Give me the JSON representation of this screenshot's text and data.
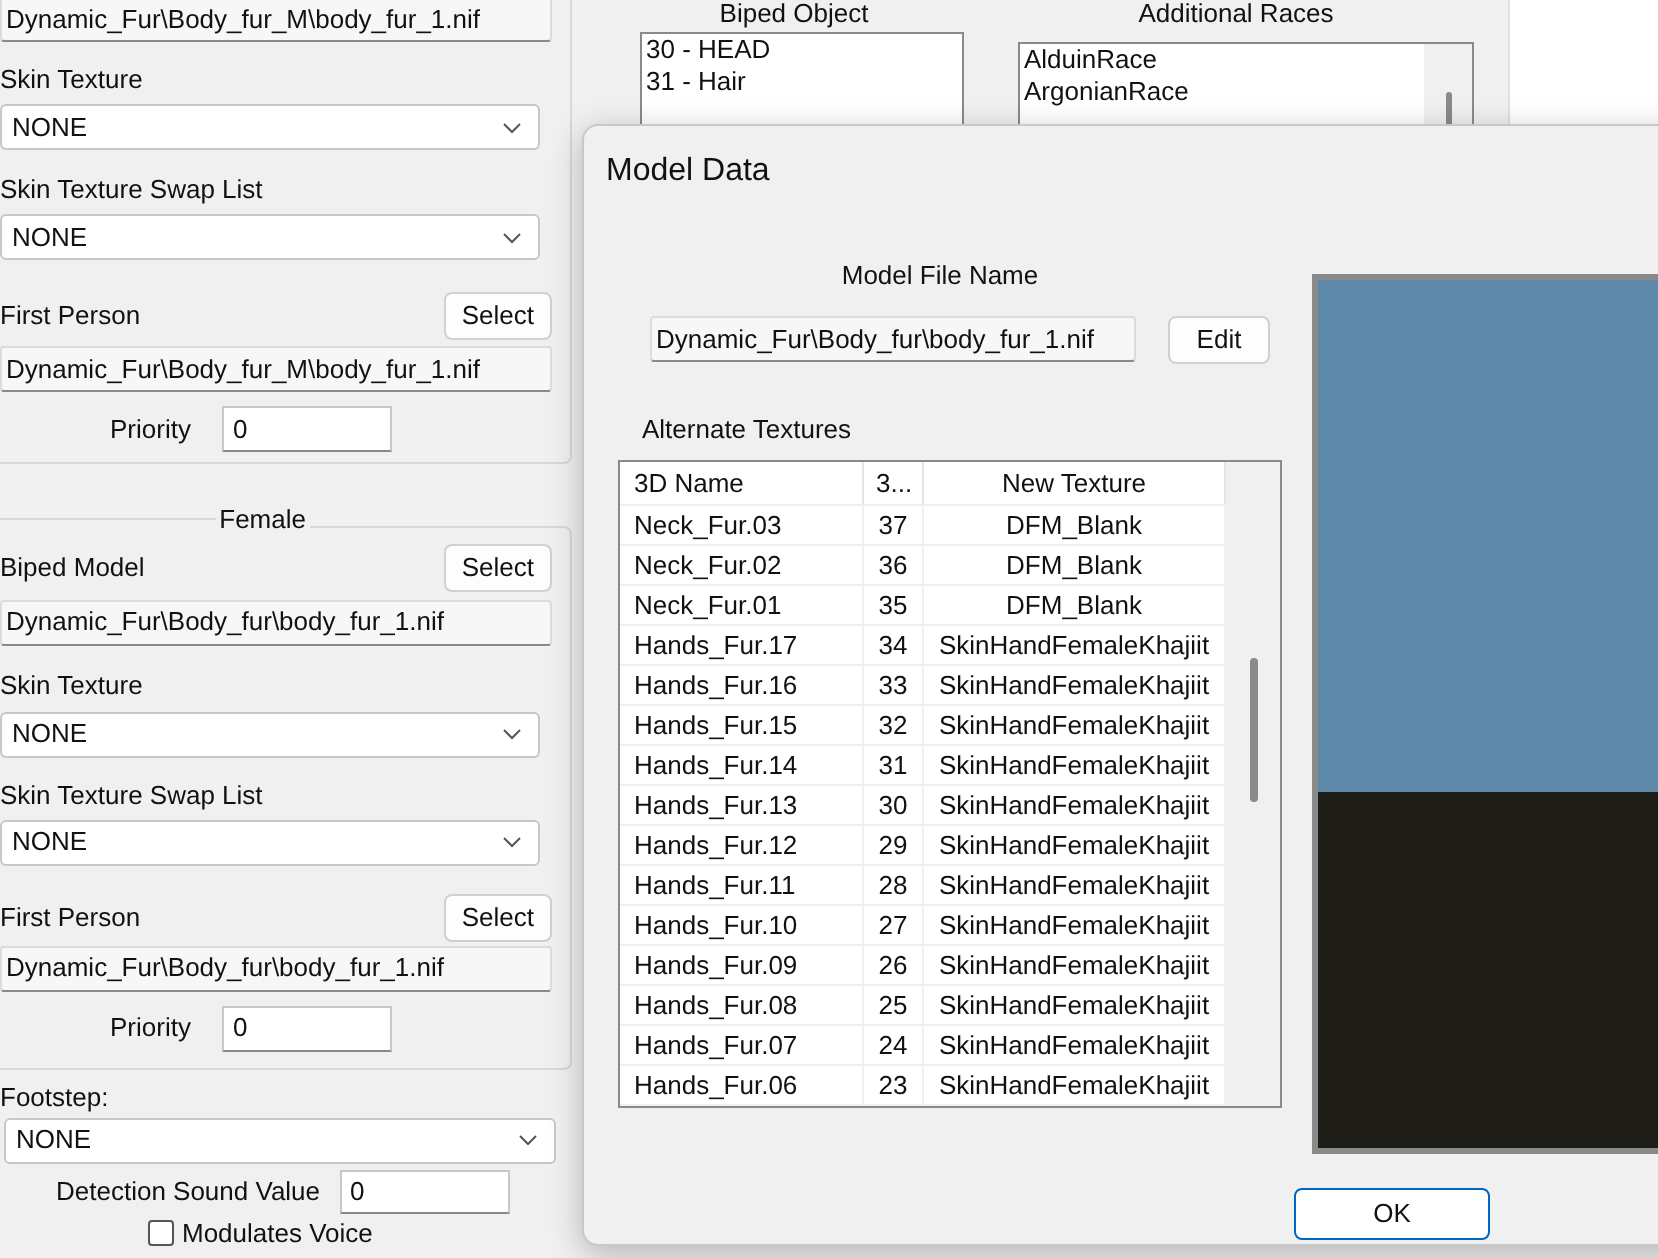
{
  "male_section": {
    "model_path": "Dynamic_Fur\\Body_fur_M\\body_fur_1.nif",
    "skin_texture": {
      "label": "Skin Texture",
      "value": "NONE"
    },
    "swap_list": {
      "label": "Skin Texture Swap List",
      "value": "NONE"
    },
    "first_person": {
      "label": "First Person",
      "button": "Select",
      "path": "Dynamic_Fur\\Body_fur_M\\body_fur_1.nif"
    },
    "priority": {
      "label": "Priority",
      "value": "0"
    }
  },
  "female_section": {
    "title": "Female",
    "biped_model": {
      "label": "Biped Model",
      "button": "Select",
      "path": "Dynamic_Fur\\Body_fur\\body_fur_1.nif"
    },
    "skin_texture": {
      "label": "Skin Texture",
      "value": "NONE"
    },
    "swap_list": {
      "label": "Skin Texture Swap List",
      "value": "NONE"
    },
    "first_person": {
      "label": "First Person",
      "button": "Select",
      "path": "Dynamic_Fur\\Body_fur\\body_fur_1.nif"
    },
    "priority": {
      "label": "Priority",
      "value": "0"
    }
  },
  "footstep": {
    "label": "Footstep:",
    "value": "NONE"
  },
  "detection_sound": {
    "label": "Detection Sound Value",
    "value": "0"
  },
  "modulates_voice": {
    "label": "Modulates Voice",
    "checked": false
  },
  "biped_object": {
    "title": "Biped Object",
    "items": [
      "30 - HEAD",
      "31 - Hair"
    ]
  },
  "additional_races": {
    "title": "Additional Races",
    "items": [
      "AlduinRace",
      "ArgonianRace"
    ]
  },
  "dialog": {
    "title": "Model Data",
    "model_file_label": "Model File Name",
    "model_file": "Dynamic_Fur\\Body_fur\\body_fur_1.nif",
    "edit_button": "Edit",
    "alternate_textures_label": "Alternate Textures",
    "table": {
      "columns": [
        "3D Name",
        "3...",
        "New Texture"
      ],
      "rows": [
        [
          "Neck_Fur.03",
          "37",
          "DFM_Blank"
        ],
        [
          "Neck_Fur.02",
          "36",
          "DFM_Blank"
        ],
        [
          "Neck_Fur.01",
          "35",
          "DFM_Blank"
        ],
        [
          "Hands_Fur.17",
          "34",
          "SkinHandFemaleKhajiit"
        ],
        [
          "Hands_Fur.16",
          "33",
          "SkinHandFemaleKhajiit"
        ],
        [
          "Hands_Fur.15",
          "32",
          "SkinHandFemaleKhajiit"
        ],
        [
          "Hands_Fur.14",
          "31",
          "SkinHandFemaleKhajiit"
        ],
        [
          "Hands_Fur.13",
          "30",
          "SkinHandFemaleKhajiit"
        ],
        [
          "Hands_Fur.12",
          "29",
          "SkinHandFemaleKhajiit"
        ],
        [
          "Hands_Fur.11",
          "28",
          "SkinHandFemaleKhajiit"
        ],
        [
          "Hands_Fur.10",
          "27",
          "SkinHandFemaleKhajiit"
        ],
        [
          "Hands_Fur.09",
          "26",
          "SkinHandFemaleKhajiit"
        ],
        [
          "Hands_Fur.08",
          "25",
          "SkinHandFemaleKhajiit"
        ],
        [
          "Hands_Fur.07",
          "24",
          "SkinHandFemaleKhajiit"
        ],
        [
          "Hands_Fur.06",
          "23",
          "SkinHandFemaleKhajiit"
        ]
      ]
    },
    "ok_button": "OK"
  }
}
